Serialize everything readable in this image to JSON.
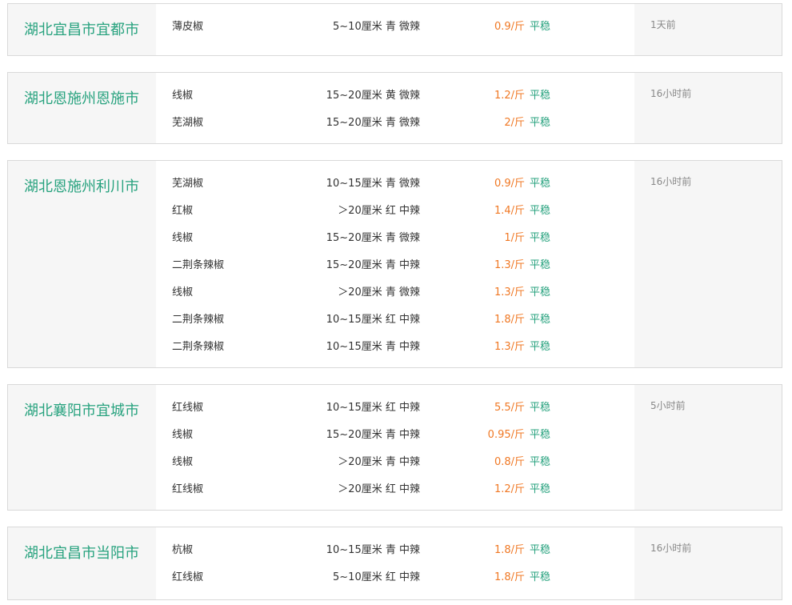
{
  "listings": [
    {
      "region": "湖北宜昌市宜都市",
      "time": "1天前",
      "items": [
        {
          "name": "薄皮椒",
          "spec": "5~10厘米 青 微辣",
          "price": "0.9/斤",
          "trend": "平稳"
        }
      ]
    },
    {
      "region": "湖北恩施州恩施市",
      "time": "16小时前",
      "items": [
        {
          "name": "线椒",
          "spec": "15~20厘米 黄 微辣",
          "price": "1.2/斤",
          "trend": "平稳"
        },
        {
          "name": "芜湖椒",
          "spec": "15~20厘米 青 微辣",
          "price": "2/斤",
          "trend": "平稳"
        }
      ]
    },
    {
      "region": "湖北恩施州利川市",
      "time": "16小时前",
      "items": [
        {
          "name": "芜湖椒",
          "spec": "10~15厘米 青 微辣",
          "price": "0.9/斤",
          "trend": "平稳"
        },
        {
          "name": "红椒",
          "spec": "＞20厘米 红 中辣",
          "price": "1.4/斤",
          "trend": "平稳"
        },
        {
          "name": "线椒",
          "spec": "15~20厘米 青 微辣",
          "price": "1/斤",
          "trend": "平稳"
        },
        {
          "name": "二荆条辣椒",
          "spec": "15~20厘米 青 中辣",
          "price": "1.3/斤",
          "trend": "平稳"
        },
        {
          "name": "线椒",
          "spec": "＞20厘米 青 微辣",
          "price": "1.3/斤",
          "trend": "平稳"
        },
        {
          "name": "二荆条辣椒",
          "spec": "10~15厘米 红 中辣",
          "price": "1.8/斤",
          "trend": "平稳"
        },
        {
          "name": "二荆条辣椒",
          "spec": "10~15厘米 青 中辣",
          "price": "1.3/斤",
          "trend": "平稳"
        }
      ]
    },
    {
      "region": "湖北襄阳市宜城市",
      "time": "5小时前",
      "items": [
        {
          "name": "红线椒",
          "spec": "10~15厘米 红 中辣",
          "price": "5.5/斤",
          "trend": "平稳"
        },
        {
          "name": "线椒",
          "spec": "15~20厘米 青 中辣",
          "price": "0.95/斤",
          "trend": "平稳"
        },
        {
          "name": "线椒",
          "spec": "＞20厘米 青 中辣",
          "price": "0.8/斤",
          "trend": "平稳"
        },
        {
          "name": "红线椒",
          "spec": "＞20厘米 红 中辣",
          "price": "1.2/斤",
          "trend": "平稳"
        }
      ]
    },
    {
      "region": "湖北宜昌市当阳市",
      "time": "16小时前",
      "items": [
        {
          "name": "杭椒",
          "spec": "10~15厘米 青 中辣",
          "price": "1.8/斤",
          "trend": "平稳"
        },
        {
          "name": "红线椒",
          "spec": "5~10厘米 红 中辣",
          "price": "1.8/斤",
          "trend": "平稳"
        }
      ]
    }
  ],
  "colors": {
    "region": "#27a27e",
    "price": "#f07824",
    "trend": "#27a27e",
    "time": "#888888",
    "card_bg": "#f6f6f6",
    "border": "#d9d9d9"
  }
}
